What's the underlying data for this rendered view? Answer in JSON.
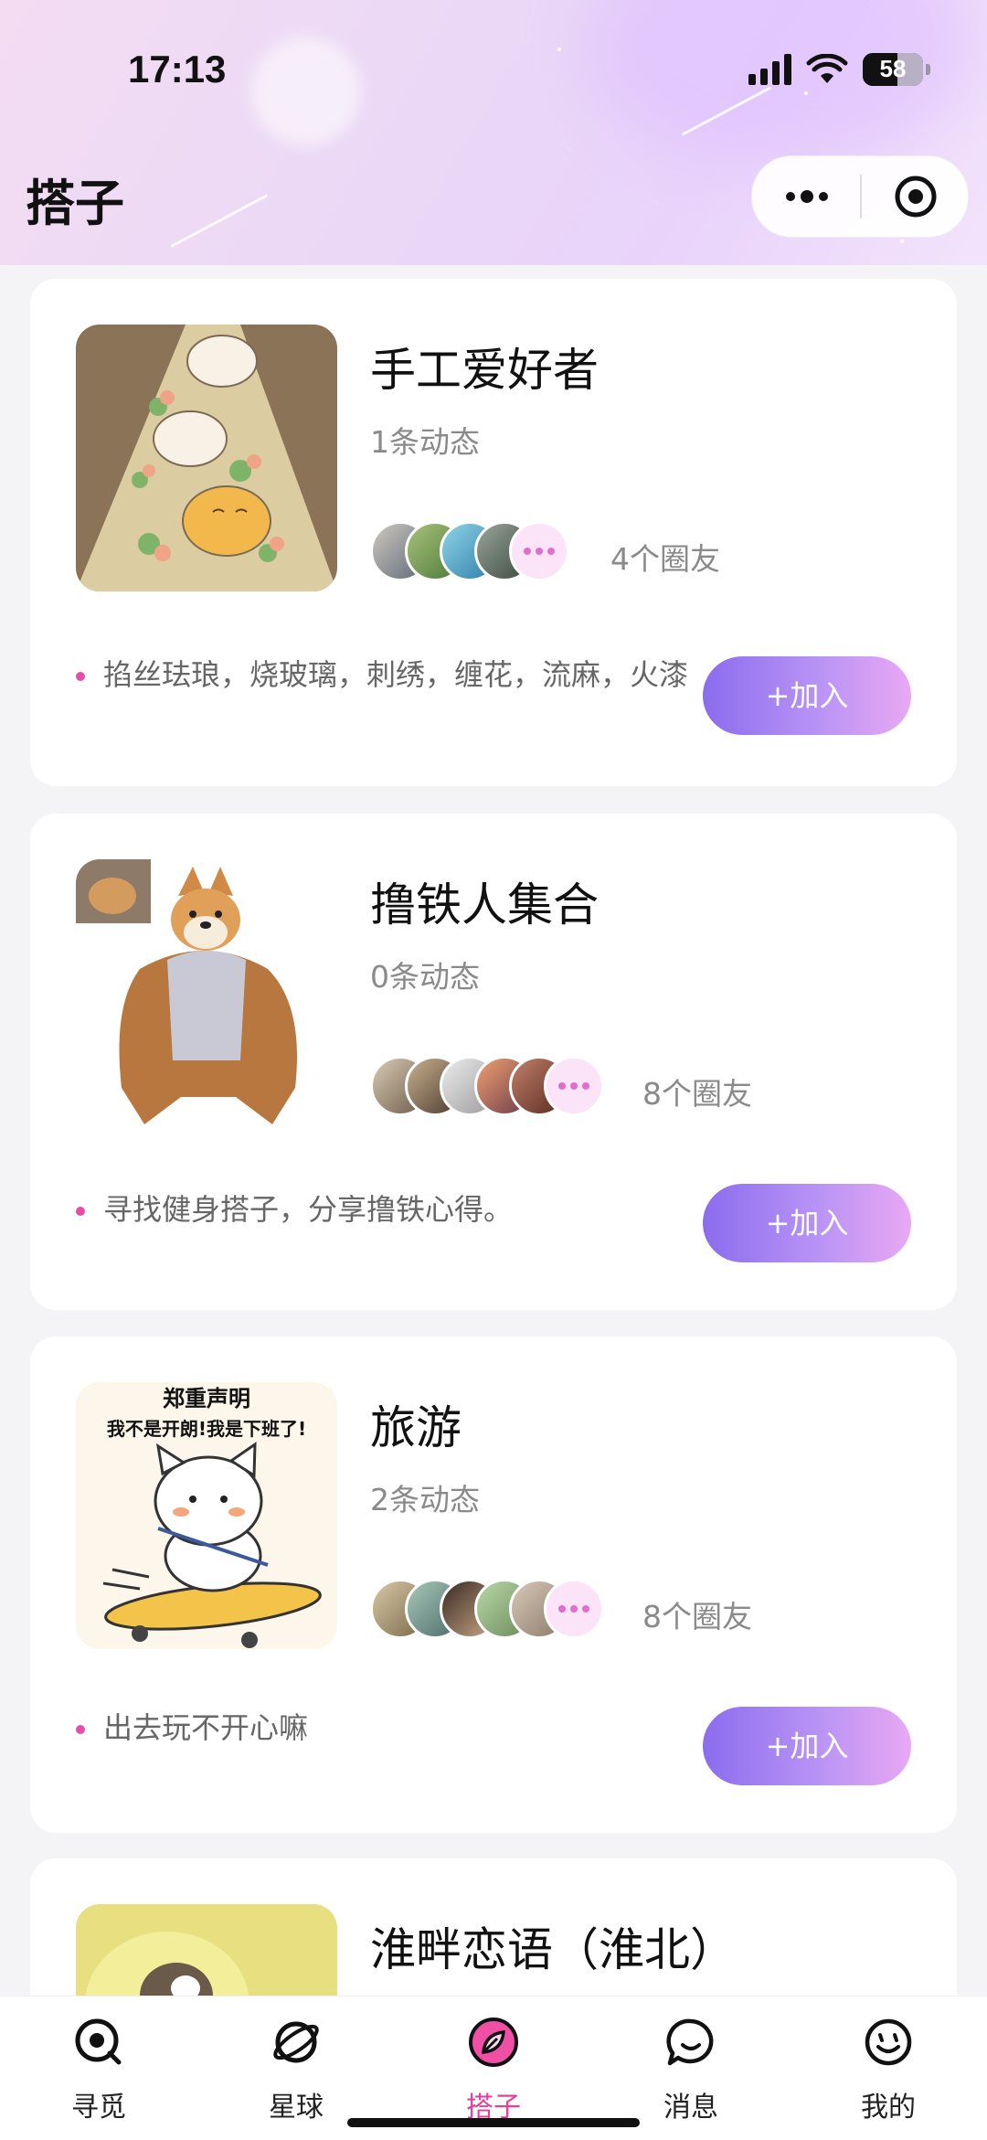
{
  "status_bar": {
    "time": "17:13",
    "battery": "58",
    "battery_level": 0.58
  },
  "header": {
    "title": "搭子"
  },
  "capsule": {
    "more_icon": "more-dots-icon",
    "close_icon": "target-circle-icon"
  },
  "cards": [
    {
      "title": "手工爱好者",
      "posts": "1条动态",
      "friends": "4个圈友",
      "tagline": "掐丝珐琅，烧玻璃，刺绣，缠花，流麻，火漆",
      "join": "+加入"
    },
    {
      "title": "撸铁人集合",
      "posts": "0条动态",
      "friends": "8个圈友",
      "tagline": "寻找健身搭子，分享撸铁心得。",
      "join": "+加入"
    },
    {
      "title": "旅游",
      "posts": "2条动态",
      "friends": "8个圈友",
      "tagline": "出去玩不开心嘛",
      "join": "+加入",
      "image_text": {
        "line1": "郑重声明",
        "line2": "我不是开朗!我是下班了!"
      }
    },
    {
      "title": "淮畔恋语（淮北）"
    }
  ],
  "nav": {
    "items": [
      {
        "label": "寻觅",
        "icon": "search-bubble-icon"
      },
      {
        "label": "星球",
        "icon": "planet-icon"
      },
      {
        "label": "搭子",
        "icon": "leaf-icon",
        "active": true
      },
      {
        "label": "消息",
        "icon": "message-bubble-icon"
      },
      {
        "label": "我的",
        "icon": "smile-face-icon"
      }
    ]
  },
  "colors": {
    "accent": "#e43f9c",
    "join_gradient_start": "#8b6cee",
    "join_gradient_end": "#e9a8f4"
  }
}
